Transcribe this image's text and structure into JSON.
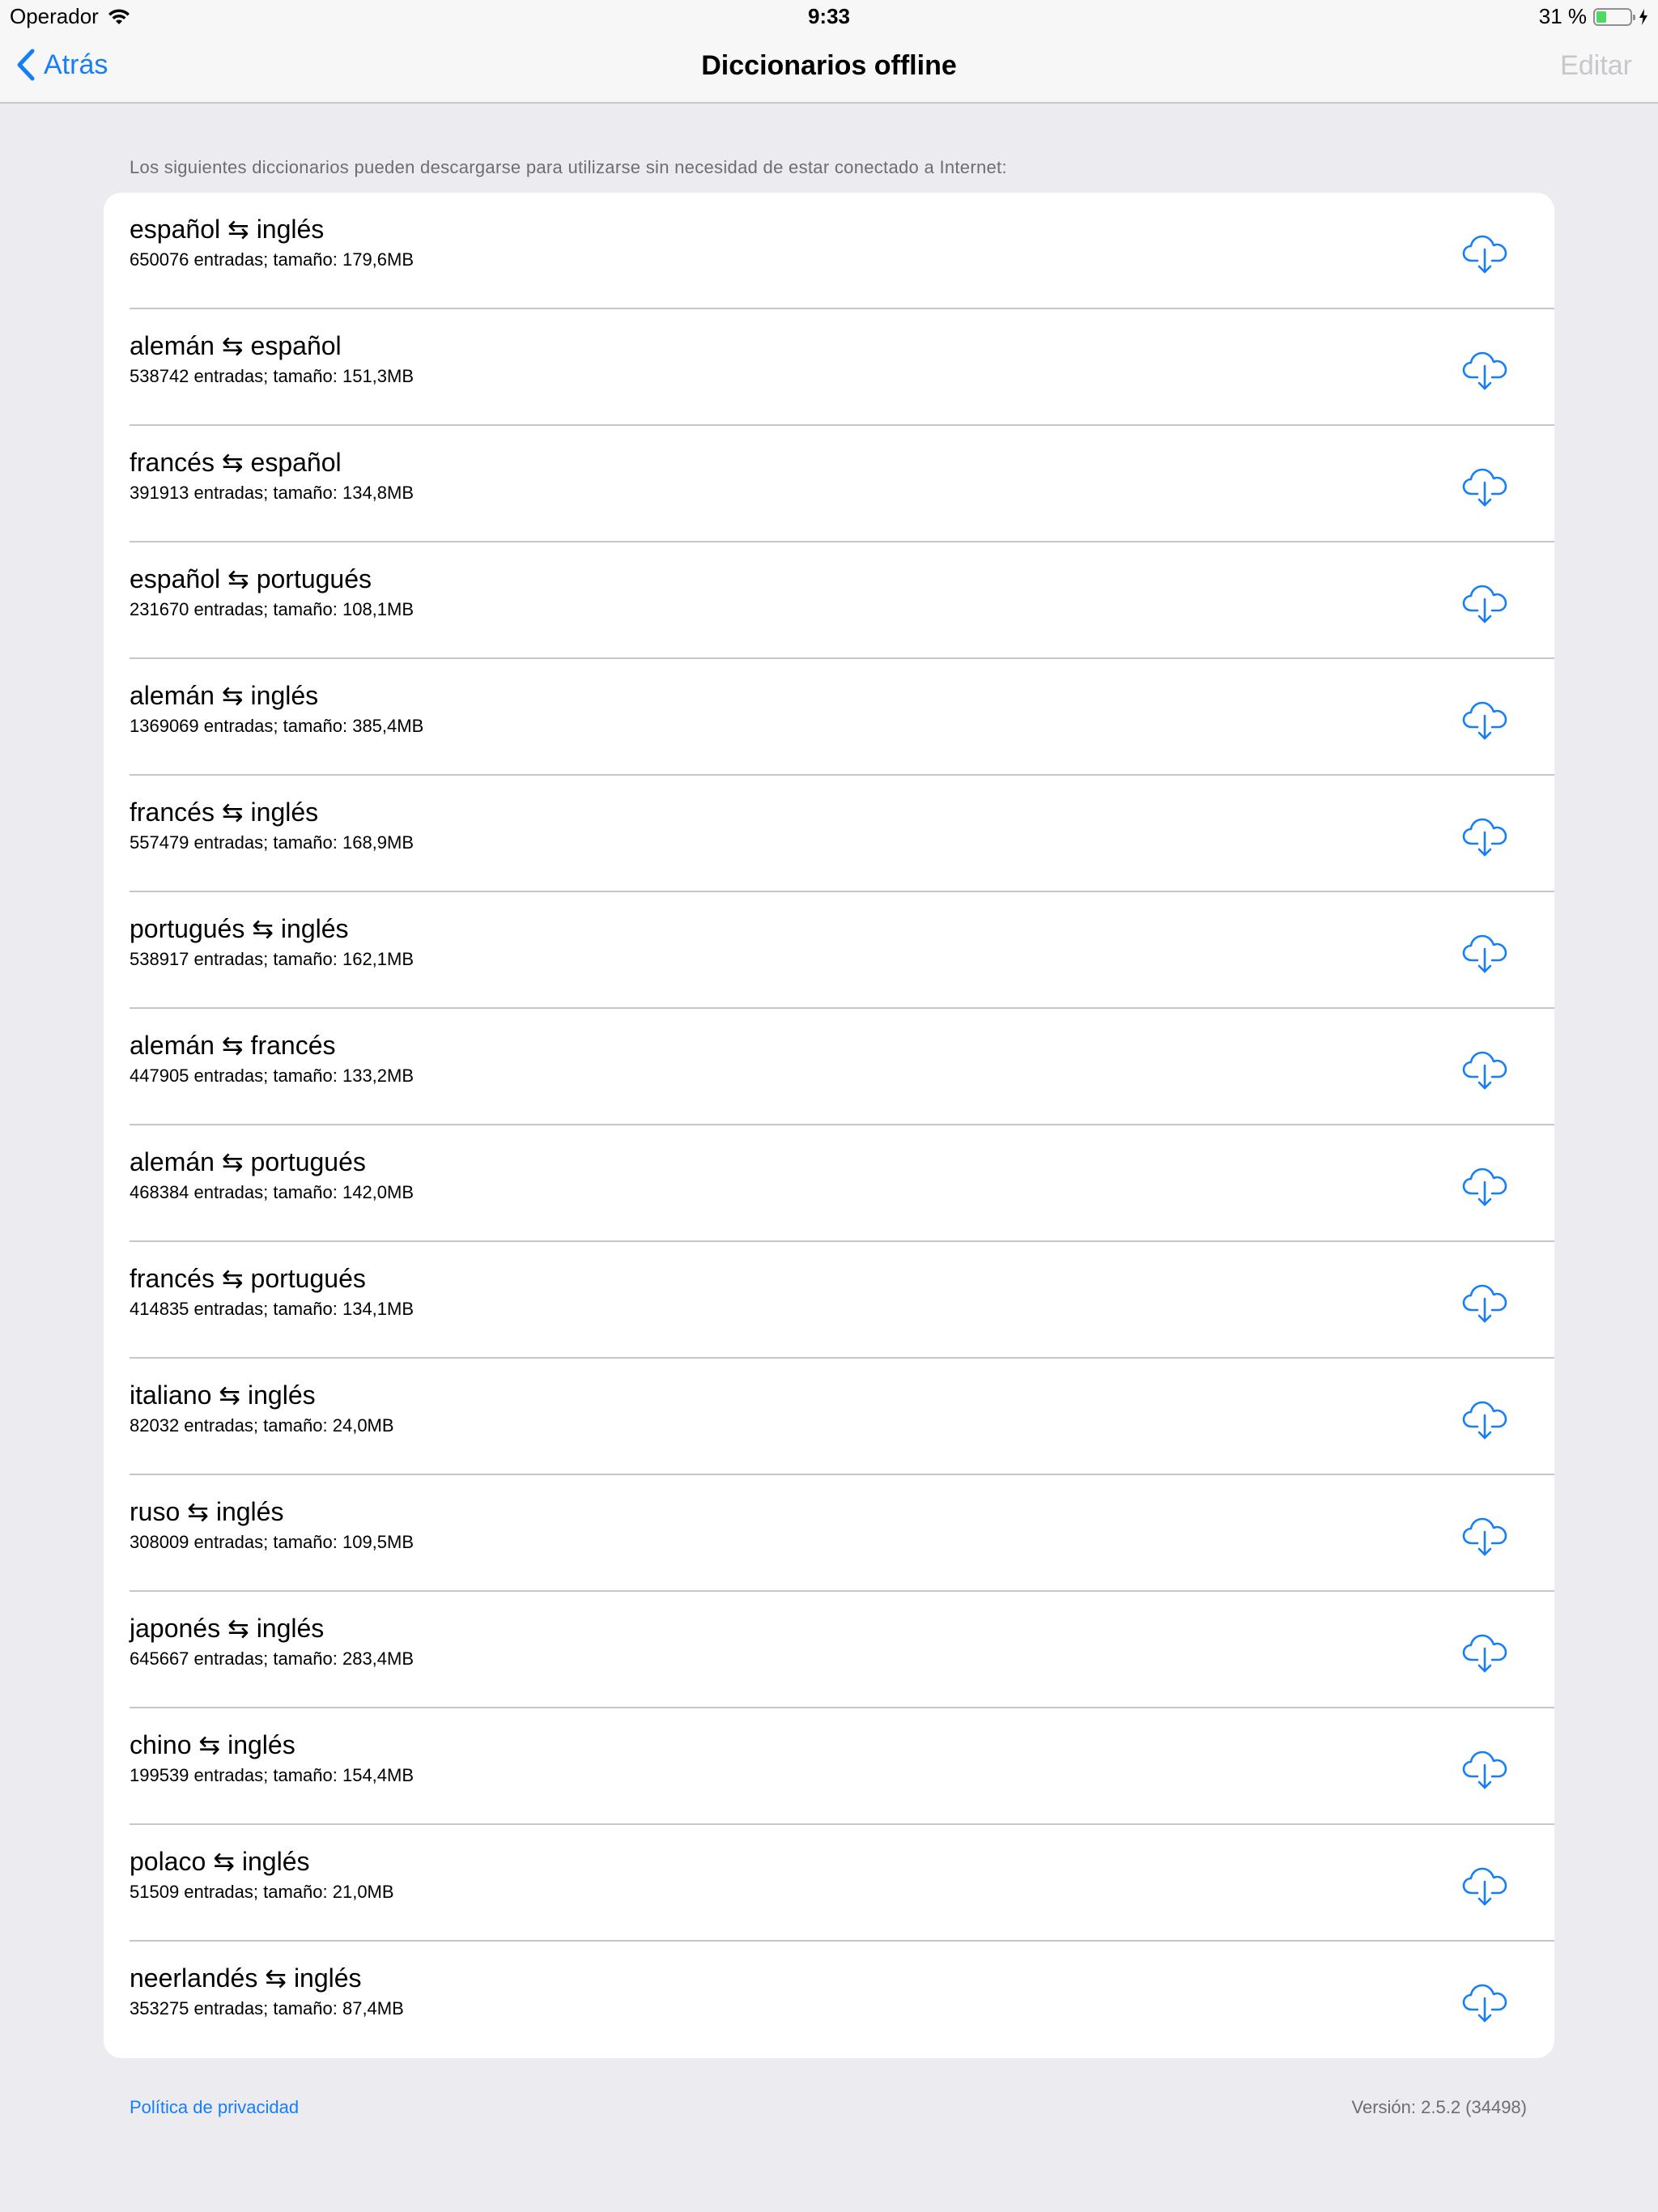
{
  "status_bar": {
    "carrier": "Operador",
    "time": "9:33",
    "battery_text": "31 %",
    "battery_level": 0.31,
    "wifi_icon": "wifi-icon",
    "charging_icon": "bolt-icon"
  },
  "nav": {
    "back_label": "Atrás",
    "title": "Diccionarios offline",
    "edit_label": "Editar"
  },
  "section_header": "Los siguientes diccionarios pueden descargarse para utilizarse sin necesidad de estar conectado a Internet:",
  "dictionaries": [
    {
      "title": "español ⇆ inglés",
      "subtitle": "650076 entradas; tamaño: 179,6MB",
      "icon": "cloud-download-icon"
    },
    {
      "title": "alemán ⇆ español",
      "subtitle": "538742 entradas; tamaño: 151,3MB",
      "icon": "cloud-download-icon"
    },
    {
      "title": "francés ⇆ español",
      "subtitle": "391913 entradas; tamaño: 134,8MB",
      "icon": "cloud-download-icon"
    },
    {
      "title": "español ⇆ portugués",
      "subtitle": "231670 entradas; tamaño: 108,1MB",
      "icon": "cloud-download-icon"
    },
    {
      "title": "alemán ⇆ inglés",
      "subtitle": "1369069 entradas; tamaño: 385,4MB",
      "icon": "cloud-download-icon"
    },
    {
      "title": "francés ⇆ inglés",
      "subtitle": "557479 entradas; tamaño: 168,9MB",
      "icon": "cloud-download-icon"
    },
    {
      "title": "portugués ⇆ inglés",
      "subtitle": "538917 entradas; tamaño: 162,1MB",
      "icon": "cloud-download-icon"
    },
    {
      "title": "alemán ⇆ francés",
      "subtitle": "447905 entradas; tamaño: 133,2MB",
      "icon": "cloud-download-icon"
    },
    {
      "title": "alemán ⇆ portugués",
      "subtitle": "468384 entradas; tamaño: 142,0MB",
      "icon": "cloud-download-icon"
    },
    {
      "title": "francés ⇆ portugués",
      "subtitle": "414835 entradas; tamaño: 134,1MB",
      "icon": "cloud-download-icon"
    },
    {
      "title": "italiano ⇆ inglés",
      "subtitle": "82032 entradas; tamaño: 24,0MB",
      "icon": "cloud-download-icon"
    },
    {
      "title": "ruso ⇆ inglés",
      "subtitle": "308009 entradas; tamaño: 109,5MB",
      "icon": "cloud-download-icon"
    },
    {
      "title": "japonés ⇆ inglés",
      "subtitle": "645667 entradas; tamaño: 283,4MB",
      "icon": "cloud-download-icon"
    },
    {
      "title": "chino ⇆ inglés",
      "subtitle": "199539 entradas; tamaño: 154,4MB",
      "icon": "cloud-download-icon"
    },
    {
      "title": "polaco ⇆ inglés",
      "subtitle": "51509 entradas; tamaño: 21,0MB",
      "icon": "cloud-download-icon"
    },
    {
      "title": "neerlandés ⇆ inglés",
      "subtitle": "353275 entradas; tamaño: 87,4MB",
      "icon": "cloud-download-icon"
    }
  ],
  "footer": {
    "privacy_label": "Política de privacidad",
    "version_label": "Versión: 2.5.2 (34498)"
  },
  "colors": {
    "accent": "#157efb",
    "background": "#ebebf0",
    "battery_green": "#4cd964",
    "disabled": "#c7c7cc"
  }
}
